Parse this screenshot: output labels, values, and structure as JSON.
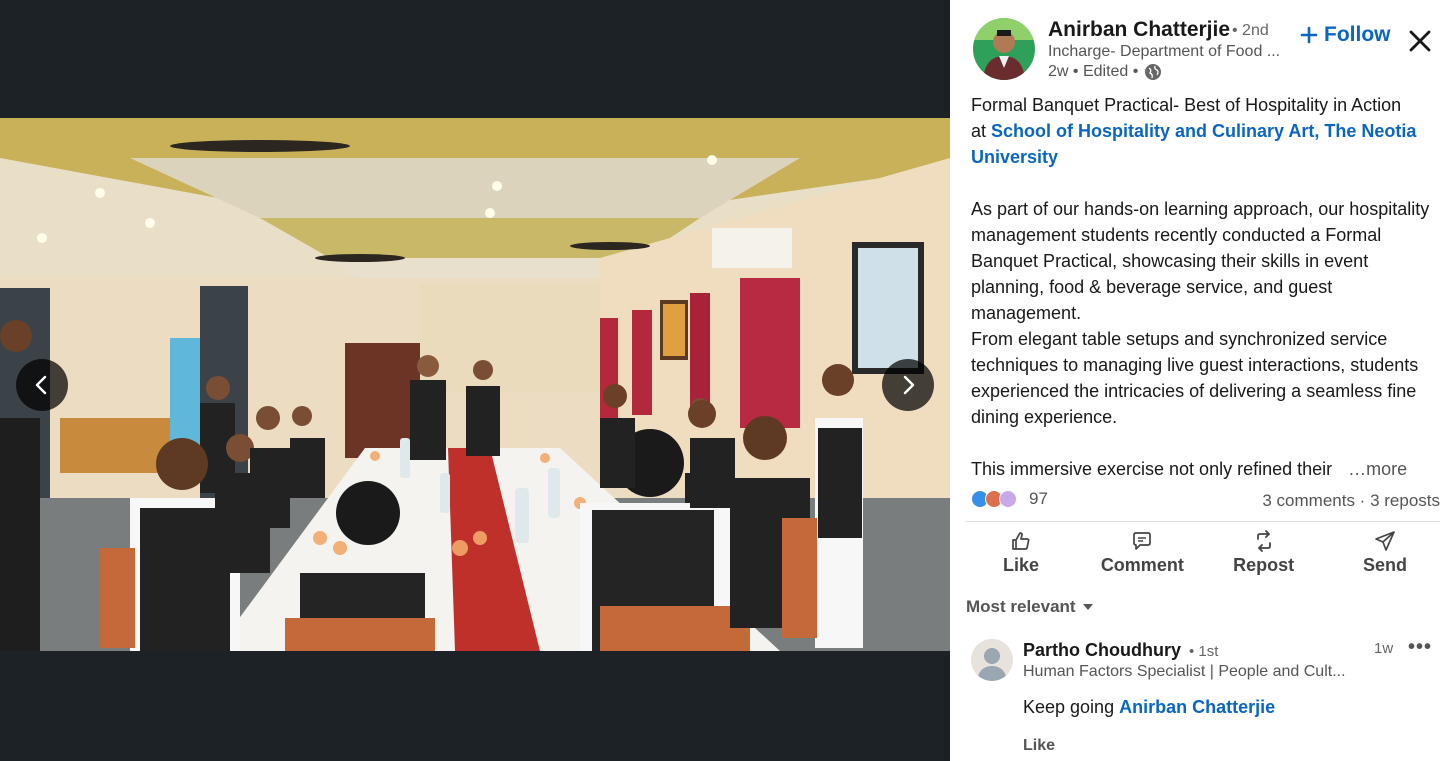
{
  "viewer": {
    "photo_alt": "Students in formal uniform raising glasses around a banquet table",
    "prev_icon": "chevron-left-icon",
    "next_icon": "chevron-right-icon"
  },
  "author": {
    "name": "Anirban Chatterjie",
    "degree": "• 2nd",
    "headline": "Incharge- Department of Food ...",
    "time": "2w • Edited •",
    "visibility_icon": "globe-icon"
  },
  "follow_label": "Follow",
  "post": {
    "line1": "Formal Banquet Practical- Best of Hospitality in Action",
    "at_prefix": "at ",
    "org_link": "School of Hospitality and Culinary Art, The Neotia University",
    "para2": "As part of our hands-on learning approach, our hospitality management students recently conducted a Formal Banquet Practical, showcasing their skills in event planning, food & beverage service, and guest management.",
    "para3": "From elegant table setups and synchronized service techniques to managing live guest interactions, students experienced the intricacies of delivering a seamless fine dining experience.",
    "para4": "This immersive exercise not only refined their",
    "more": "…more"
  },
  "social": {
    "reaction_count": "97",
    "counts": "3 comments · 3 reposts"
  },
  "actions": [
    {
      "label": "Like",
      "icon": "thumbs-up-icon"
    },
    {
      "label": "Comment",
      "icon": "comment-icon"
    },
    {
      "label": "Repost",
      "icon": "repost-icon"
    },
    {
      "label": "Send",
      "icon": "send-icon"
    }
  ],
  "sort_label": "Most relevant",
  "comment": {
    "name": "Partho Choudhury",
    "degree": "• 1st",
    "headline": "Human Factors Specialist | People and Cult...",
    "time": "1w",
    "menu": "•••",
    "text_prefix": "Keep going ",
    "mention": "Anirban Chatterjie",
    "like_label": "Like"
  },
  "colors": {
    "link": "#0a66c2",
    "viewer_bg": "#1d2226",
    "table_runner": "#c0302a"
  }
}
